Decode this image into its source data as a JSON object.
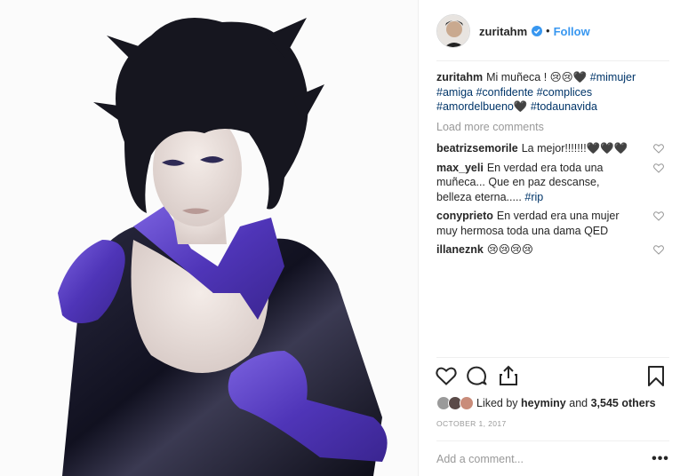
{
  "post": {
    "author": "zuritahm",
    "verified": true,
    "follow_label": "Follow",
    "separator": "•",
    "avatar_icon": "profile-avatar",
    "photo_alt": "Portrait photo"
  },
  "caption": {
    "user": "zuritahm",
    "text": "Mi muñeca ! 😢😢🖤",
    "tags": [
      "#mimujer",
      "#amiga",
      "#confidente",
      "#complices",
      "#amordelbueno🖤",
      "#todaunavida"
    ]
  },
  "load_more_label": "Load more comments",
  "comments": [
    {
      "user": "beatrizsemorile",
      "text": "La mejor!!!!!!!🖤🖤🖤",
      "tag": ""
    },
    {
      "user": "max_yeli",
      "text": "En verdad era toda una muñeca... Que en paz descanse, belleza eterna..... ",
      "tag": "#rip"
    },
    {
      "user": "conyprieto",
      "text": "En verdad era una mujer muy hermosa toda una dama QED",
      "tag": ""
    },
    {
      "user": "illaneznk",
      "text": "😢😢😢😢",
      "tag": ""
    }
  ],
  "actions": {
    "like_icon": "heart-icon",
    "comment_icon": "comment-icon",
    "share_icon": "share-icon",
    "save_icon": "bookmark-icon"
  },
  "likes": {
    "prefix": "Liked by",
    "user": "heyminy",
    "middle": "and",
    "count": "3,545 others"
  },
  "date": "OCTOBER 1, 2017",
  "add_comment": {
    "placeholder": "Add a comment...",
    "more_label": "•••"
  },
  "colors": {
    "link": "#3897f0",
    "hashtag": "#003569",
    "muted": "#999999",
    "suit": "#5b3fbf",
    "latex": "#1c1b2e"
  }
}
